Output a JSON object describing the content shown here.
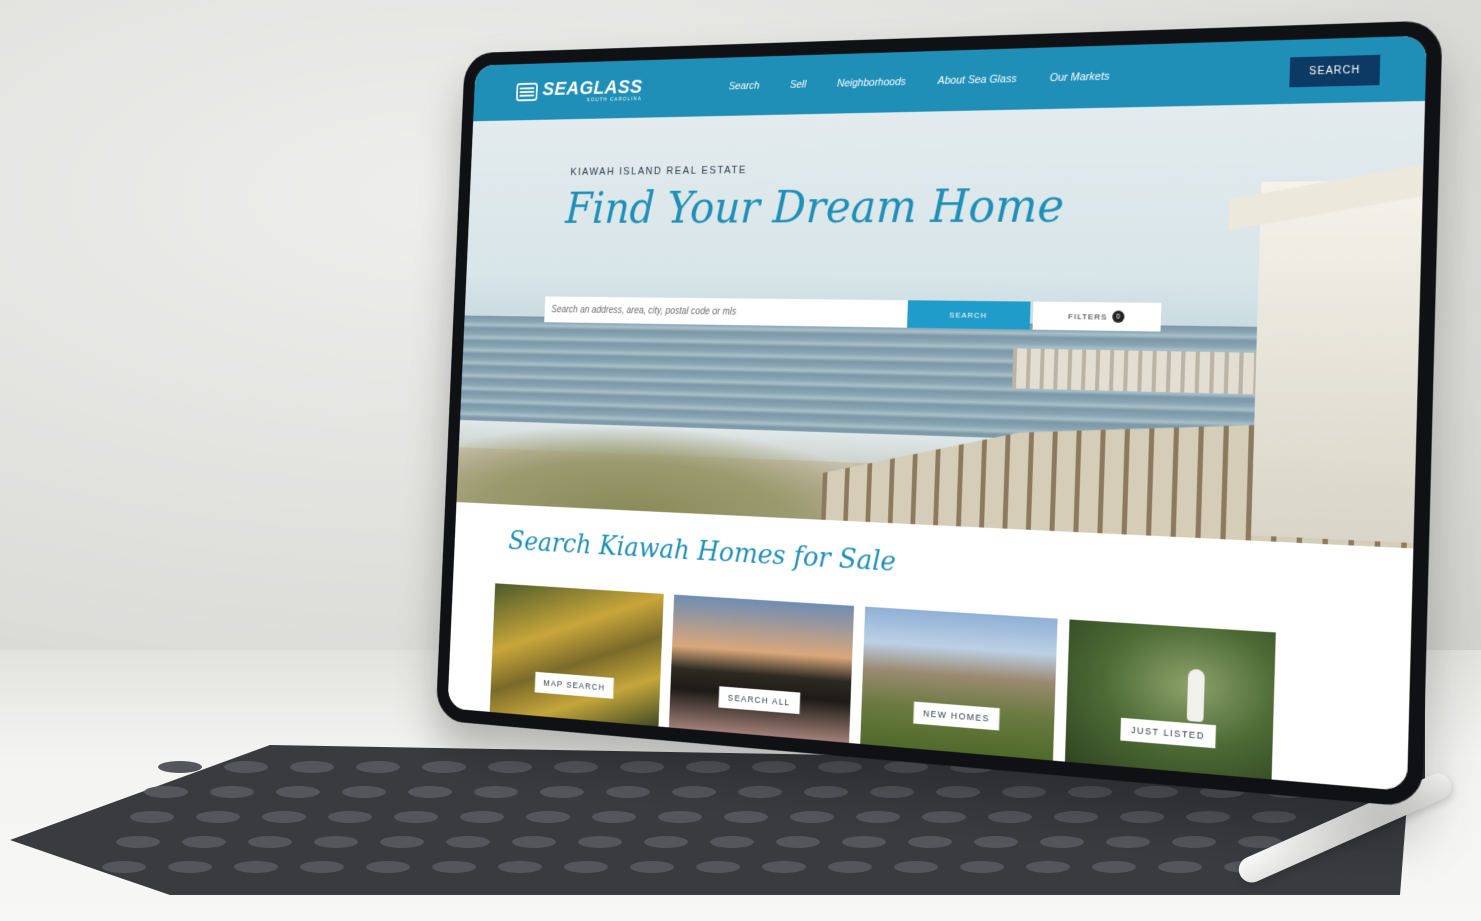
{
  "brand": {
    "name": "SEAGLASS",
    "tagline": "SOUTH CAROLINA"
  },
  "nav": {
    "items": [
      "Search",
      "Sell",
      "Neighborhoods",
      "About Sea Glass",
      "Our Markets"
    ],
    "search_button": "SEARCH"
  },
  "hero": {
    "eyebrow": "KIAWAH ISLAND REAL ESTATE",
    "title": "Find Your Dream Home",
    "search_placeholder": "Search an address, area, city, postal code or mls",
    "search_button": "SEARCH",
    "filters_button": "FILTERS",
    "filters_count": "0"
  },
  "section": {
    "title": "Search Kiawah Homes for Sale",
    "cards": [
      {
        "label": "MAP SEARCH"
      },
      {
        "label": "SEARCH ALL"
      },
      {
        "label": "NEW HOMES"
      },
      {
        "label": "JUST LISTED"
      }
    ]
  },
  "colors": {
    "nav": "#1f8fb8",
    "accent": "#1f9cc9",
    "nav_button": "#0d3a64",
    "heading": "#1f8fb8"
  }
}
